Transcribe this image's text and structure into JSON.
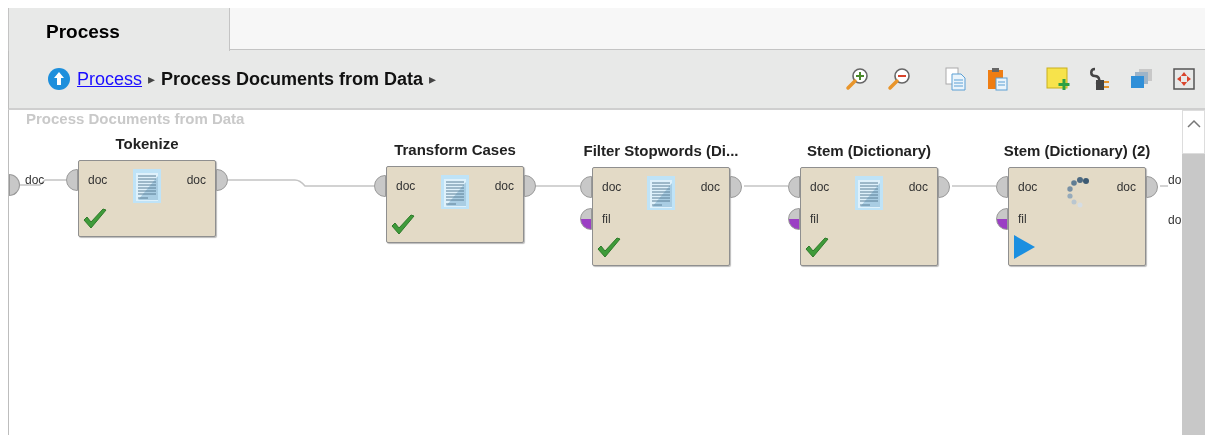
{
  "tabs": [
    {
      "label": "Process",
      "selected": true
    }
  ],
  "breadcrumb": {
    "items": [
      {
        "label": "Process",
        "kind": "link"
      },
      {
        "label": "▸",
        "kind": "separator"
      },
      {
        "label": "Process Documents from Data",
        "kind": "current"
      },
      {
        "label": "▸",
        "kind": "separator"
      }
    ]
  },
  "canvas": {
    "title": "Process Documents from Data",
    "input_ports": [
      "doc"
    ],
    "output_ports": [
      "do",
      "do"
    ],
    "operators": [
      {
        "name": "Tokenize",
        "kind": "done",
        "inputs": [
          {
            "label": "doc",
            "color": "#c8c8c8"
          }
        ],
        "outputs": [
          "doc"
        ]
      },
      {
        "name": "Transform Cases",
        "kind": "done",
        "inputs": [
          {
            "label": "doc",
            "color": "#c8c8c8"
          }
        ],
        "outputs": [
          "doc"
        ]
      },
      {
        "name": "Filter Stopwords (Di...",
        "kind": "done",
        "inputs": [
          {
            "label": "doc",
            "color": "#c8c8c8"
          },
          {
            "label": "fil",
            "color": "#9b3fc4"
          }
        ],
        "outputs": [
          "doc"
        ]
      },
      {
        "name": "Stem (Dictionary)",
        "kind": "done",
        "inputs": [
          {
            "label": "doc",
            "color": "#c8c8c8"
          },
          {
            "label": "fil",
            "color": "#9b3fc4"
          }
        ],
        "outputs": [
          "doc"
        ]
      },
      {
        "name": "Stem (Dictionary) (2)",
        "kind": "running",
        "inputs": [
          {
            "label": "doc",
            "color": "#c8c8c8"
          },
          {
            "label": "fil",
            "color": "#9b3fc4"
          }
        ],
        "outputs": [
          "doc"
        ]
      }
    ]
  }
}
